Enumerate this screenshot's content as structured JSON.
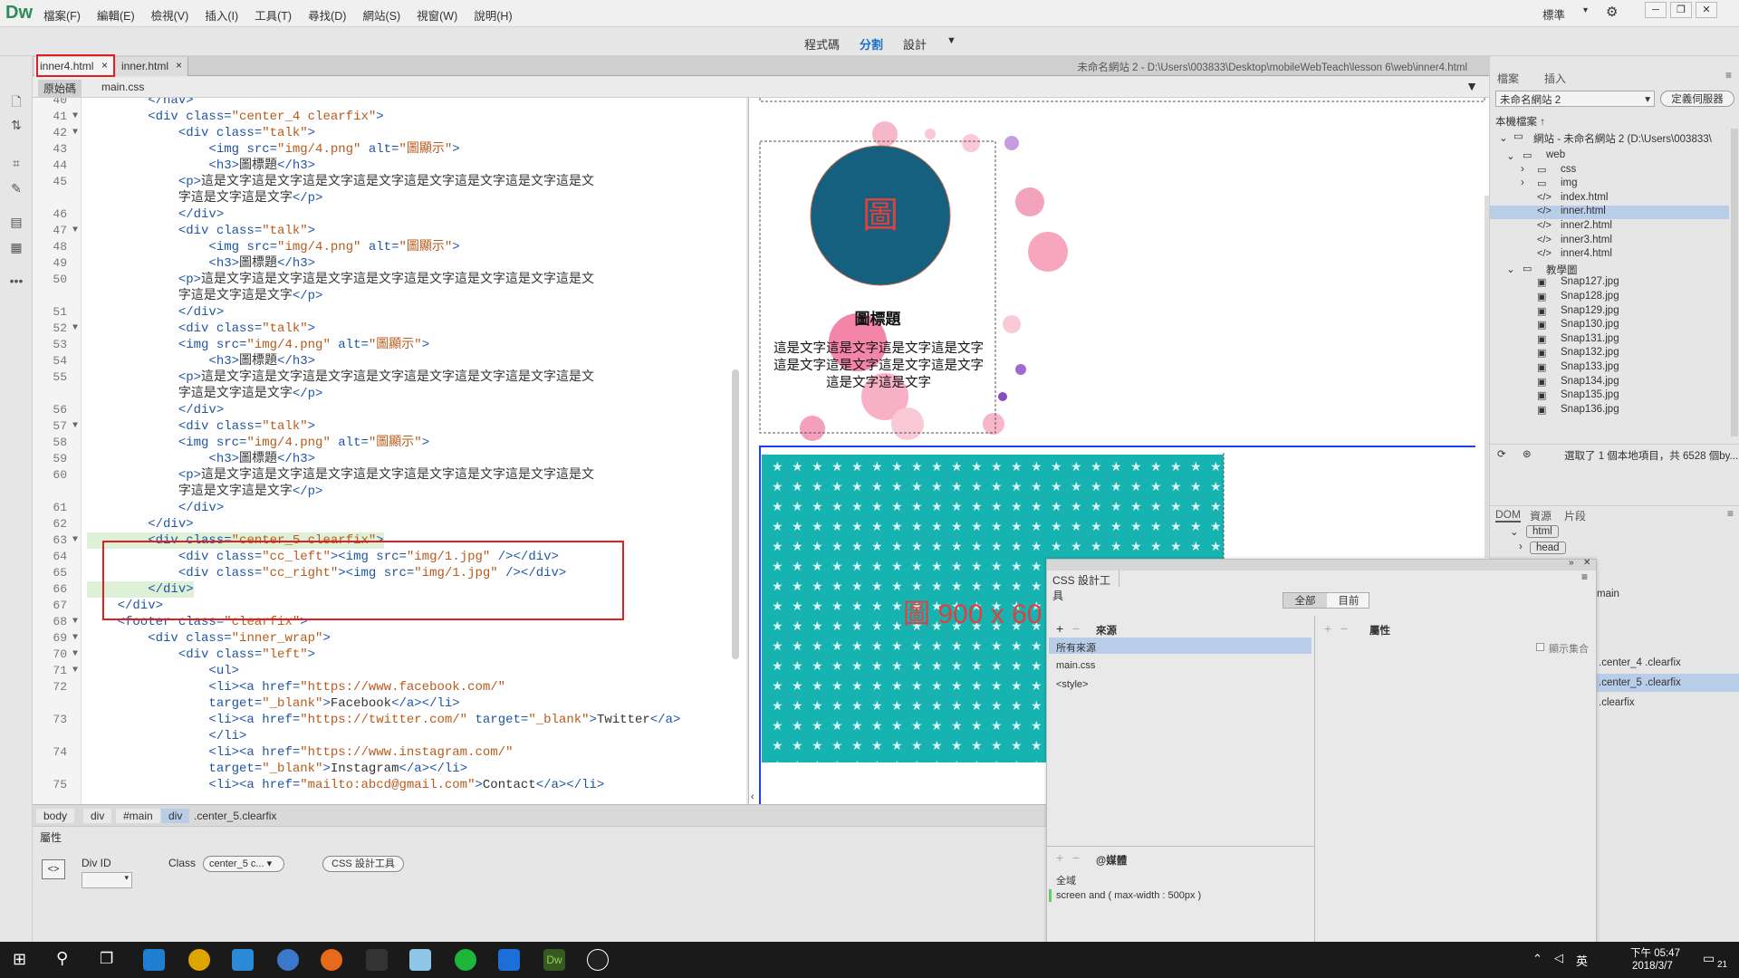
{
  "menubar": {
    "app_logo": "Dw",
    "items": [
      "檔案(F)",
      "編輯(E)",
      "檢視(V)",
      "插入(I)",
      "工具(T)",
      "尋找(D)",
      "網站(S)",
      "視窗(W)",
      "說明(H)"
    ],
    "workspace": "標準"
  },
  "viewbar": {
    "code": "程式碼",
    "split": "分割",
    "design": "設計"
  },
  "tabs": [
    {
      "label": "inner4.html",
      "close": "×"
    },
    {
      "label": "inner.html",
      "close": "×"
    }
  ],
  "docpath": "未命名網站 2 - D:\\Users\\003833\\Desktop\\mobileWebTeach\\lesson 6\\web\\inner4.html",
  "srcbar": {
    "source": "原始碼",
    "css": "main.css"
  },
  "code_lines": [
    {
      "n": "40",
      "f": "",
      "t": [
        [
          "t",
          "        </nav>"
        ]
      ]
    },
    {
      "n": "41",
      "f": "▼",
      "t": [
        [
          "t",
          "        <div "
        ],
        [
          "a",
          "class="
        ],
        [
          "v",
          "\"center_4 clearfix\""
        ],
        [
          "t",
          ">"
        ]
      ]
    },
    {
      "n": "42",
      "f": "▼",
      "t": [
        [
          "t",
          "            <div "
        ],
        [
          "a",
          "class="
        ],
        [
          "v",
          "\"talk\""
        ],
        [
          "t",
          ">"
        ]
      ]
    },
    {
      "n": "43",
      "f": "",
      "t": [
        [
          "t",
          "                <img "
        ],
        [
          "a",
          "src="
        ],
        [
          "v",
          "\"img/4.png\""
        ],
        [
          "a",
          " alt="
        ],
        [
          "v",
          "\"圖顯示\""
        ],
        [
          "t",
          ">"
        ]
      ]
    },
    {
      "n": "44",
      "f": "",
      "t": [
        [
          "t",
          "                <h3>"
        ],
        [
          "p",
          "圖標題"
        ],
        [
          "t",
          "</h3>"
        ]
      ]
    },
    {
      "n": "45",
      "f": "",
      "t": [
        [
          "t",
          "            <p>"
        ],
        [
          "p",
          "這是文字這是文字這是文字這是文字這是文字這是文字這是文字這是文"
        ]
      ]
    },
    {
      "n": "",
      "f": "",
      "t": [
        [
          "p",
          "            字這是文字這是文字"
        ],
        [
          "t",
          "</p>"
        ]
      ]
    },
    {
      "n": "46",
      "f": "",
      "t": [
        [
          "t",
          "            </div>"
        ]
      ]
    },
    {
      "n": "47",
      "f": "▼",
      "t": [
        [
          "t",
          "            <div "
        ],
        [
          "a",
          "class="
        ],
        [
          "v",
          "\"talk\""
        ],
        [
          "t",
          ">"
        ]
      ]
    },
    {
      "n": "48",
      "f": "",
      "t": [
        [
          "t",
          "                <img "
        ],
        [
          "a",
          "src="
        ],
        [
          "v",
          "\"img/4.png\""
        ],
        [
          "a",
          " alt="
        ],
        [
          "v",
          "\"圖顯示\""
        ],
        [
          "t",
          ">"
        ]
      ]
    },
    {
      "n": "49",
      "f": "",
      "t": [
        [
          "t",
          "                <h3>"
        ],
        [
          "p",
          "圖標題"
        ],
        [
          "t",
          "</h3>"
        ]
      ]
    },
    {
      "n": "50",
      "f": "",
      "t": [
        [
          "t",
          "            <p>"
        ],
        [
          "p",
          "這是文字這是文字這是文字這是文字這是文字這是文字這是文字這是文"
        ]
      ]
    },
    {
      "n": "",
      "f": "",
      "t": [
        [
          "p",
          "            字這是文字這是文字"
        ],
        [
          "t",
          "</p>"
        ]
      ]
    },
    {
      "n": "51",
      "f": "",
      "t": [
        [
          "t",
          "            </div>"
        ]
      ]
    },
    {
      "n": "52",
      "f": "▼",
      "t": [
        [
          "t",
          "            <div "
        ],
        [
          "a",
          "class="
        ],
        [
          "v",
          "\"talk\""
        ],
        [
          "t",
          ">"
        ]
      ]
    },
    {
      "n": "53",
      "f": "",
      "t": [
        [
          "t",
          "            <img "
        ],
        [
          "a",
          "src="
        ],
        [
          "v",
          "\"img/4.png\""
        ],
        [
          "a",
          " alt="
        ],
        [
          "v",
          "\"圖顯示\""
        ],
        [
          "t",
          ">"
        ]
      ]
    },
    {
      "n": "54",
      "f": "",
      "t": [
        [
          "t",
          "                <h3>"
        ],
        [
          "p",
          "圖標題"
        ],
        [
          "t",
          "</h3>"
        ]
      ]
    },
    {
      "n": "55",
      "f": "",
      "t": [
        [
          "t",
          "            <p>"
        ],
        [
          "p",
          "這是文字這是文字這是文字這是文字這是文字這是文字這是文字這是文"
        ]
      ]
    },
    {
      "n": "",
      "f": "",
      "t": [
        [
          "p",
          "            字這是文字這是文字"
        ],
        [
          "t",
          "</p>"
        ]
      ]
    },
    {
      "n": "56",
      "f": "",
      "t": [
        [
          "t",
          "            </div>"
        ]
      ]
    },
    {
      "n": "57",
      "f": "▼",
      "t": [
        [
          "t",
          "            <div "
        ],
        [
          "a",
          "class="
        ],
        [
          "v",
          "\"talk\""
        ],
        [
          "t",
          ">"
        ]
      ]
    },
    {
      "n": "58",
      "f": "",
      "t": [
        [
          "t",
          "            <img "
        ],
        [
          "a",
          "src="
        ],
        [
          "v",
          "\"img/4.png\""
        ],
        [
          "a",
          " alt="
        ],
        [
          "v",
          "\"圖顯示\""
        ],
        [
          "t",
          ">"
        ]
      ]
    },
    {
      "n": "59",
      "f": "",
      "t": [
        [
          "t",
          "                <h3>"
        ],
        [
          "p",
          "圖標題"
        ],
        [
          "t",
          "</h3>"
        ]
      ]
    },
    {
      "n": "60",
      "f": "",
      "t": [
        [
          "t",
          "            <p>"
        ],
        [
          "p",
          "這是文字這是文字這是文字這是文字這是文字這是文字這是文字這是文"
        ]
      ]
    },
    {
      "n": "",
      "f": "",
      "t": [
        [
          "p",
          "            字這是文字這是文字"
        ],
        [
          "t",
          "</p>"
        ]
      ]
    },
    {
      "n": "61",
      "f": "",
      "t": [
        [
          "t",
          "            </div>"
        ]
      ]
    },
    {
      "n": "62",
      "f": "",
      "t": [
        [
          "t",
          "        </div>"
        ]
      ]
    },
    {
      "n": "63",
      "f": "▼",
      "t": [
        [
          "t",
          "        <div "
        ],
        [
          "a",
          "class="
        ],
        [
          "v",
          "\"center_5 clearfix\""
        ],
        [
          "t",
          ">"
        ]
      ]
    },
    {
      "n": "64",
      "f": "",
      "t": [
        [
          "t",
          "            <div "
        ],
        [
          "a",
          "class="
        ],
        [
          "v",
          "\"cc_left\""
        ],
        [
          "t",
          "><img "
        ],
        [
          "a",
          "src="
        ],
        [
          "v",
          "\"img/1.jpg\""
        ],
        [
          "t",
          " /></div>"
        ]
      ]
    },
    {
      "n": "65",
      "f": "",
      "t": [
        [
          "t",
          "            <div "
        ],
        [
          "a",
          "class="
        ],
        [
          "v",
          "\"cc_right\""
        ],
        [
          "t",
          "><img "
        ],
        [
          "a",
          "src="
        ],
        [
          "v",
          "\"img/1.jpg\""
        ],
        [
          "t",
          " /></div>"
        ]
      ]
    },
    {
      "n": "66",
      "f": "",
      "t": [
        [
          "t",
          "        </div>"
        ]
      ]
    },
    {
      "n": "67",
      "f": "",
      "t": [
        [
          "t",
          "    </div>"
        ]
      ]
    },
    {
      "n": "68",
      "f": "▼",
      "t": [
        [
          "t",
          "    <footer "
        ],
        [
          "a",
          "class="
        ],
        [
          "v",
          "\"clearfix\""
        ],
        [
          "t",
          ">"
        ]
      ]
    },
    {
      "n": "69",
      "f": "▼",
      "t": [
        [
          "t",
          "        <div "
        ],
        [
          "a",
          "class="
        ],
        [
          "v",
          "\"inner_wrap\""
        ],
        [
          "t",
          ">"
        ]
      ]
    },
    {
      "n": "70",
      "f": "▼",
      "t": [
        [
          "t",
          "            <div "
        ],
        [
          "a",
          "class="
        ],
        [
          "v",
          "\"left\""
        ],
        [
          "t",
          ">"
        ]
      ]
    },
    {
      "n": "71",
      "f": "▼",
      "t": [
        [
          "t",
          "                <ul>"
        ]
      ]
    },
    {
      "n": "72",
      "f": "",
      "t": [
        [
          "t",
          "                <li><a "
        ],
        [
          "a",
          "href="
        ],
        [
          "v",
          "\"https://www.facebook.com/\""
        ]
      ]
    },
    {
      "n": "",
      "f": "",
      "t": [
        [
          "a",
          "                target="
        ],
        [
          "v",
          "\"_blank\""
        ],
        [
          "t",
          ">"
        ],
        [
          "p",
          "Facebook"
        ],
        [
          "t",
          "</a></li>"
        ]
      ]
    },
    {
      "n": "73",
      "f": "",
      "t": [
        [
          "t",
          "                <li><a "
        ],
        [
          "a",
          "href="
        ],
        [
          "v",
          "\"https://twitter.com/\""
        ],
        [
          "a",
          " target="
        ],
        [
          "v",
          "\"_blank\""
        ],
        [
          "t",
          ">"
        ],
        [
          "p",
          "Twitter"
        ],
        [
          "t",
          "</a>"
        ]
      ]
    },
    {
      "n": "",
      "f": "",
      "t": [
        [
          "t",
          "                </li>"
        ]
      ]
    },
    {
      "n": "74",
      "f": "",
      "t": [
        [
          "t",
          "                <li><a "
        ],
        [
          "a",
          "href="
        ],
        [
          "v",
          "\"https://www.instagram.com/\""
        ]
      ]
    },
    {
      "n": "",
      "f": "",
      "t": [
        [
          "a",
          "                target="
        ],
        [
          "v",
          "\"_blank\""
        ],
        [
          "t",
          ">"
        ],
        [
          "p",
          "Instagram"
        ],
        [
          "t",
          "</a></li>"
        ]
      ]
    },
    {
      "n": "75",
      "f": "",
      "t": [
        [
          "t",
          "                <li><a "
        ],
        [
          "a",
          "href="
        ],
        [
          "v",
          "\"mailto:abcd@gmail.com\""
        ],
        [
          "t",
          ">"
        ],
        [
          "p",
          "Contact"
        ],
        [
          "t",
          "</a></li>"
        ]
      ]
    }
  ],
  "design": {
    "circle_char": "圖",
    "title": "圖標題",
    "body": "這是文字這是文字這是文字這是文字這是文字這是文字這是文字這是文字這是文字這是文字",
    "banner": "圖  900 x 60"
  },
  "tagbar": [
    "body",
    "div",
    "#main",
    "div",
    ".center_5.clearfix"
  ],
  "props": {
    "title": "屬性",
    "divid": "Div ID",
    "class_label": "Class",
    "class_value": "center_5 c...",
    "css_btn": "CSS 設計工具"
  },
  "files": {
    "tab1": "檔案",
    "tab2": "插入",
    "site": "未命名網站 2",
    "manage": "定義伺服器",
    "local": "本機檔案 ↑",
    "root": "網站 - 未命名網站 2 (D:\\Users\\003833\\",
    "items": [
      {
        "l": "web",
        "d": 1,
        "t": "folder"
      },
      {
        "l": "css",
        "d": 2,
        "t": "folder"
      },
      {
        "l": "img",
        "d": 2,
        "t": "folder"
      },
      {
        "l": "index.html",
        "d": 2,
        "t": "html"
      },
      {
        "l": "inner.html",
        "d": 2,
        "t": "html"
      },
      {
        "l": "inner2.html",
        "d": 2,
        "t": "html"
      },
      {
        "l": "inner3.html",
        "d": 2,
        "t": "html"
      },
      {
        "l": "inner4.html",
        "d": 2,
        "t": "html"
      },
      {
        "l": "教學圖",
        "d": 1,
        "t": "folder"
      },
      {
        "l": "Snap127.jpg",
        "d": 2,
        "t": "img"
      },
      {
        "l": "Snap128.jpg",
        "d": 2,
        "t": "img"
      },
      {
        "l": "Snap129.jpg",
        "d": 2,
        "t": "img"
      },
      {
        "l": "Snap130.jpg",
        "d": 2,
        "t": "img"
      },
      {
        "l": "Snap131.jpg",
        "d": 2,
        "t": "img"
      },
      {
        "l": "Snap132.jpg",
        "d": 2,
        "t": "img"
      },
      {
        "l": "Snap133.jpg",
        "d": 2,
        "t": "img"
      },
      {
        "l": "Snap134.jpg",
        "d": 2,
        "t": "img"
      },
      {
        "l": "Snap135.jpg",
        "d": 2,
        "t": "img"
      },
      {
        "l": "Snap136.jpg",
        "d": 2,
        "t": "img"
      }
    ],
    "status": "選取了 1 個本地項目，共 6528 個by..."
  },
  "dom": {
    "tab1": "DOM",
    "tab2": "資源",
    "tab3": "片段",
    "html": "html",
    "head": "head",
    "main": "main",
    "cf4": ".center_4 .clearfix",
    "cf5": ".center_5 .clearfix",
    "cf": ".clearfix"
  },
  "cssd": {
    "title": "CSS 設計工具",
    "all": "全部",
    "current": "目前",
    "sources": "來源",
    "props": "屬性",
    "src_items": [
      "所有來源",
      "main.css",
      "<style>"
    ],
    "show_set": "顯示集合",
    "media": "@媒體",
    "global": "全域",
    "mq": "screen and ( max-width : 500px )"
  },
  "taskbar": {
    "time": "下午 05:47",
    "date": "2018/3/7",
    "ime": "英",
    "badge": "21"
  }
}
